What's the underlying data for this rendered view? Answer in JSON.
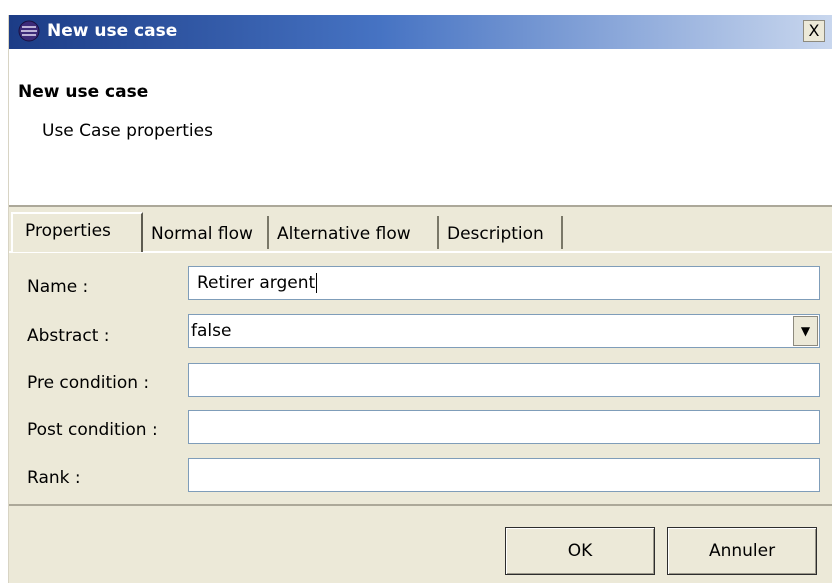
{
  "window": {
    "title": "New use case",
    "close_label": "X"
  },
  "header": {
    "title": "New use case",
    "subtitle": "Use Case properties"
  },
  "tabs": [
    {
      "label": "Properties",
      "active": true
    },
    {
      "label": "Normal flow",
      "active": false
    },
    {
      "label": "Alternative flow",
      "active": false
    },
    {
      "label": "Description",
      "active": false
    }
  ],
  "form": {
    "name": {
      "label": "Name :",
      "value": "Retirer argent"
    },
    "abstract": {
      "label": "Abstract :",
      "value": "false"
    },
    "pre_condition": {
      "label": "Pre condition :",
      "value": ""
    },
    "post_condition": {
      "label": "Post condition :",
      "value": ""
    },
    "rank": {
      "label": "Rank :",
      "value": ""
    }
  },
  "buttons": {
    "ok_label": "OK",
    "cancel_label": "Annuler"
  },
  "icons": {
    "app": "eclipse-app-icon",
    "close": "close-icon",
    "dropdown": "chevron-down-icon"
  },
  "colors": {
    "titlebar_start": "#1c3c86",
    "titlebar_end": "#c9d7ee",
    "dialog_background": "#ece9d8",
    "input_border": "#7f9db9"
  }
}
